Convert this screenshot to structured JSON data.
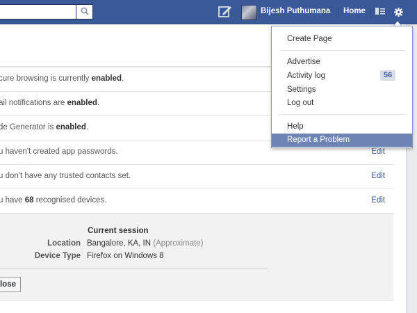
{
  "topbar": {
    "search": {
      "value": "",
      "placeholder": ""
    },
    "profile_name": "Bijesh Puthumana",
    "home": "Home"
  },
  "security_rows": [
    {
      "prefix": "cure browsing is currently ",
      "bold": "enabled",
      "suffix": ".",
      "action": ""
    },
    {
      "prefix": "ail notifications are ",
      "bold": "enabled",
      "suffix": ".",
      "action": ""
    },
    {
      "prefix": "de Generator is ",
      "bold": "enabled",
      "suffix": ".",
      "action": ""
    },
    {
      "prefix": "u haven't created app passwords.",
      "bold": "",
      "suffix": "",
      "action": "Edit"
    },
    {
      "prefix": "u don't have any trusted contacts set.",
      "bold": "",
      "suffix": "",
      "action": "Edit"
    },
    {
      "prefix": "u have ",
      "bold": "68",
      "suffix": " recognised devices.",
      "action": "Edit"
    }
  ],
  "session": {
    "title": "Current session",
    "location_label": "Location",
    "location_value": "Bangalore, KA, IN",
    "location_note": "(Approximate)",
    "device_label": "Device Type",
    "device_value": "Firefox on Windows 8",
    "close_button": "lose"
  },
  "menu": {
    "create_page": "Create Page",
    "advertise": "Advertise",
    "activity_log": "Activity log",
    "activity_count": "56",
    "settings": "Settings",
    "log_out": "Log out",
    "help": "Help",
    "report_problem": "Report a Problem"
  },
  "colors": {
    "brand": "#3b5998",
    "menu_highlight": "#6d84b4",
    "badge_bg": "#d8dfea"
  }
}
